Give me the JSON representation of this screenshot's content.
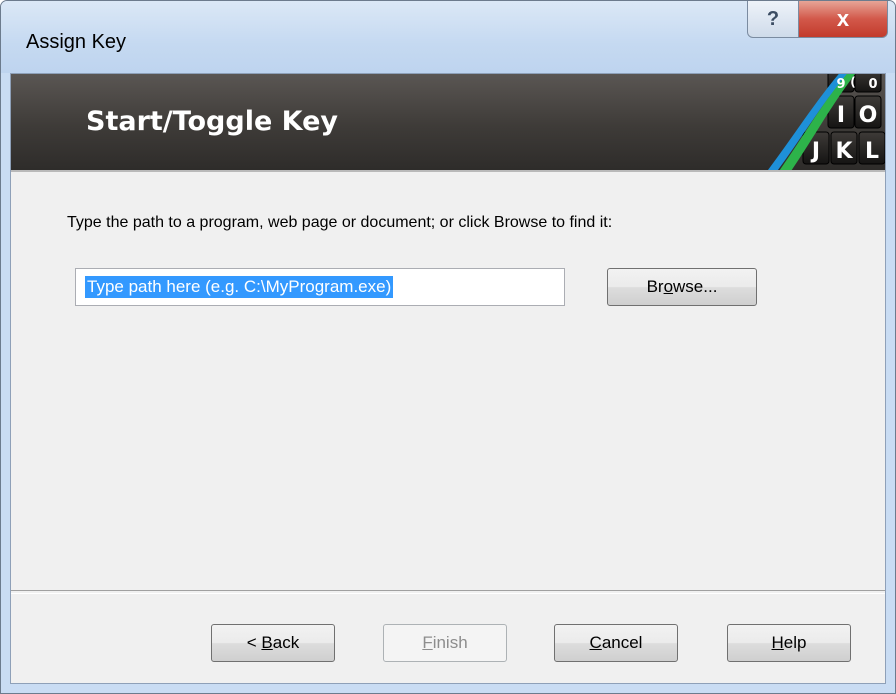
{
  "window": {
    "title": "Assign Key",
    "help_glyph": "?",
    "close_glyph": "x"
  },
  "banner": {
    "title": "Start/Toggle Key",
    "art_icon": "keyboard-keys-graphic",
    "key_labels": [
      "9",
      "(",
      "0",
      "I",
      "O",
      "J",
      "K",
      "L"
    ],
    "stripe_colors": [
      "#2db34a",
      "#1e90d8"
    ]
  },
  "body": {
    "instruction": "Type the path to a program, web page or document; or click Browse to find it:",
    "path_value": "Type path here (e.g. C:\\MyProgram.exe)"
  },
  "buttons": {
    "browse": {
      "pre": "Br",
      "mn": "o",
      "post": "wse..."
    },
    "back": {
      "pre": "< ",
      "mn": "B",
      "post": "ack"
    },
    "finish": {
      "pre": "",
      "mn": "F",
      "post": "inish"
    },
    "cancel": {
      "pre": "",
      "mn": "C",
      "post": "ancel"
    },
    "help": {
      "pre": "",
      "mn": "H",
      "post": "elp"
    }
  }
}
